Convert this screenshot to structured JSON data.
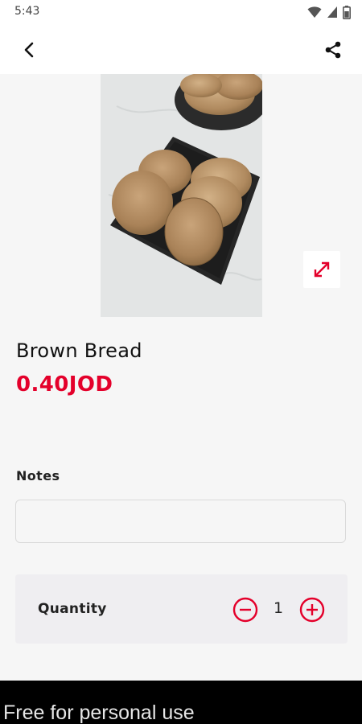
{
  "status_bar": {
    "time": "5:43",
    "icons": [
      "wifi-icon",
      "cell-signal-icon",
      "battery-icon"
    ]
  },
  "app_bar": {
    "back_icon": "chevron-left-icon",
    "share_icon": "share-icon"
  },
  "product": {
    "name": "Brown Bread",
    "price": "0.40JOD",
    "image_description_icon": "bread-photo",
    "expand_icon": "expand-icon"
  },
  "notes": {
    "label": "Notes",
    "value": "",
    "placeholder": ""
  },
  "quantity": {
    "label": "Quantity",
    "value": "1",
    "minus_icon": "minus-circle-icon",
    "plus_icon": "plus-circle-icon"
  },
  "footer": {
    "watermark": "Free for personal use"
  },
  "colors": {
    "accent": "#e4002b",
    "background": "#f6f6f6",
    "quantity_bg": "#efeef1",
    "footer_bg": "#000000"
  }
}
